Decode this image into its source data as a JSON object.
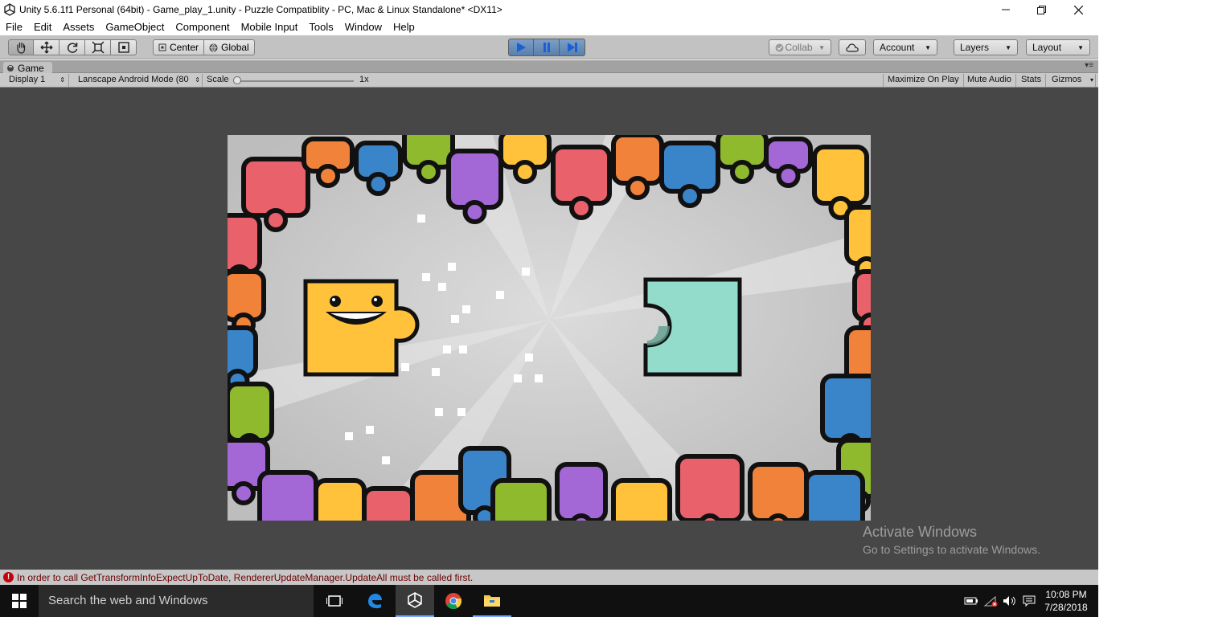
{
  "window": {
    "title": "Unity 5.6.1f1 Personal (64bit) - Game_play_1.unity - Puzzle Compatiblity - PC, Mac & Linux Standalone* <DX11>",
    "minimize_icon": "minimize-icon",
    "maximize_icon": "restore-icon",
    "close_icon": "close-icon"
  },
  "menu": [
    "File",
    "Edit",
    "Assets",
    "GameObject",
    "Component",
    "Mobile Input",
    "Tools",
    "Window",
    "Help"
  ],
  "toolbar": {
    "tools": [
      "hand-icon",
      "move-icon",
      "rotate-icon",
      "scale-icon",
      "rect-icon"
    ],
    "pivot_label": "Center",
    "space_label": "Global",
    "play_icons": [
      "play-icon",
      "pause-icon",
      "step-icon"
    ],
    "collab_label": "Collab",
    "account_label": "Account",
    "layers_label": "Layers",
    "layout_label": "Layout",
    "play_color": "#4a78b0"
  },
  "game_panel": {
    "tab_label": "Game",
    "display_label": "Display 1",
    "aspect_label": "Lanscape Android Mode (80",
    "scale_label": "Scale",
    "scale_value": "1x",
    "maximize_label": "Maximize On Play",
    "mute_label": "Mute Audio",
    "stats_label": "Stats",
    "gizmos_label": "Gizmos"
  },
  "game_colors": {
    "background": "#cfcfcf",
    "yellow_piece": "#ffc23a",
    "teal_piece": "#93dccb",
    "puzzle_colors": [
      "#e9616a",
      "#f0823a",
      "#3a85c9",
      "#8fba2e",
      "#a467d6",
      "#ffc23a"
    ]
  },
  "watermark": {
    "line1": "Activate Windows",
    "line2": "Go to Settings to activate Windows."
  },
  "status": {
    "message": "In order to call GetTransformInfoExpectUpToDate, RendererUpdateManager.UpdateAll must be called first."
  },
  "taskbar": {
    "search_placeholder": "Search the web and Windows",
    "time": "10:08 PM",
    "date": "7/28/2018",
    "apps": [
      "task-view-icon",
      "edge-icon",
      "unity-icon",
      "chrome-icon",
      "file-explorer-icon"
    ]
  }
}
